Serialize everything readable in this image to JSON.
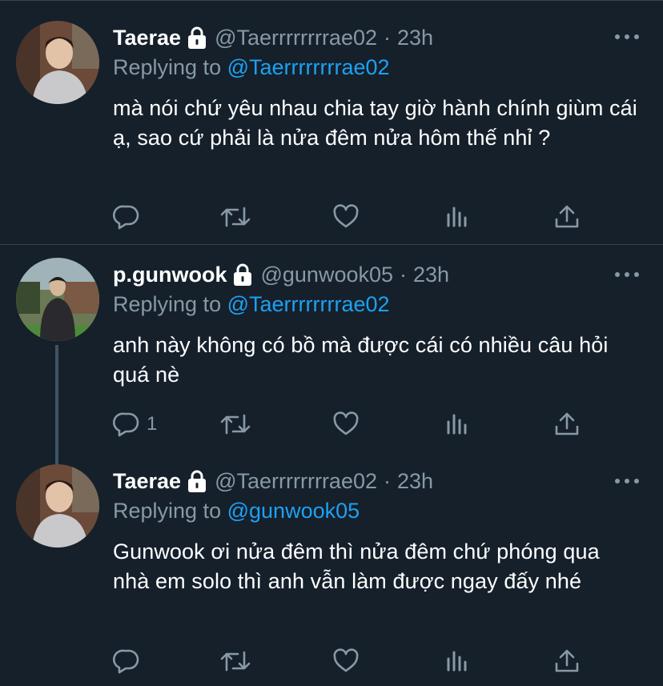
{
  "tweets": [
    {
      "name": "Taerae",
      "handle": "@Taerrrrrrrrae02",
      "time": "23h",
      "reply_prefix": "Replying to",
      "reply_to": "@Taerrrrrrrrae02",
      "text": "mà nói chứ yêu nhau chia tay giờ hành chính giùm cái ạ, sao cứ phải là nửa đêm nửa hôm thế nhỉ ?",
      "reply_count": ""
    },
    {
      "name": "p.gunwook",
      "handle": "@gunwook05",
      "time": "23h",
      "reply_prefix": "Replying to",
      "reply_to": "@Taerrrrrrrrae02",
      "text": "anh này không có bồ mà được cái có nhiều câu hỏi quá nè",
      "reply_count": "1"
    },
    {
      "name": "Taerae",
      "handle": "@Taerrrrrrrrae02",
      "time": "23h",
      "reply_prefix": "Replying to",
      "reply_to": "@gunwook05",
      "text": "Gunwook ơi nửa đêm thì nửa đêm chứ phóng qua nhà em solo thì anh vẫn làm được ngay đấy nhé",
      "reply_count": ""
    }
  ],
  "separator": "·",
  "icons": [
    "lock-icon",
    "more-icon",
    "reply-icon",
    "retweet-icon",
    "like-icon",
    "analytics-icon",
    "share-icon"
  ],
  "colors": {
    "background": "#15202b",
    "divider": "#38444d",
    "secondary_text": "#8899a6",
    "link": "#1da1f2",
    "thread_line": "#3d5466"
  }
}
